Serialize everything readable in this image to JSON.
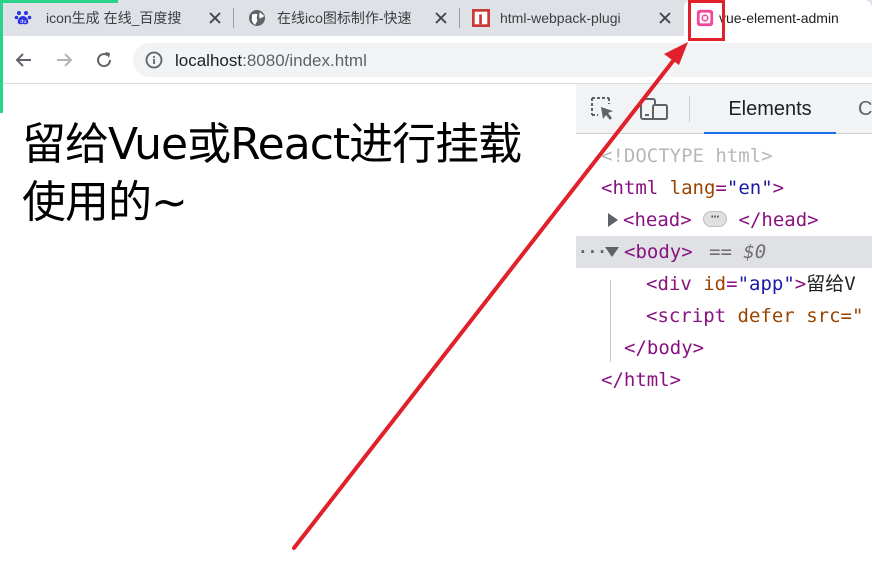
{
  "browser": {
    "tabs": [
      {
        "title": "icon生成 在线_百度搜",
        "favicon": "baidu-paw-icon"
      },
      {
        "title": "在线ico图标制作-快速",
        "favicon": "globe-icon"
      },
      {
        "title": "html-webpack-plugi",
        "favicon": "npm-icon"
      },
      {
        "title": "vue-element-admin",
        "favicon": "vue-element-admin-icon",
        "active": true
      }
    ],
    "close_glyph": "✕",
    "url_host": "localhost",
    "url_path": ":8080/index.html"
  },
  "page": {
    "text": "留给Vue或React进行挂载使用的~"
  },
  "devtools": {
    "tabs": [
      {
        "label": "Elements",
        "active": true
      },
      {
        "label": "C"
      }
    ],
    "dom": {
      "doctype": "<!DOCTYPE html>",
      "html_open_tag": "<html",
      "html_attr_name": "lang",
      "html_attr_value": "\"en\"",
      "html_open_close": ">",
      "head_open": "<head>",
      "head_close": "</head>",
      "ellipsis": "⋯",
      "body_open": "<body>",
      "body_selected_marker": "== $0",
      "row_dots": "···",
      "div_open": "<div",
      "div_attr_name": "id",
      "div_attr_value": "\"app\"",
      "div_gt": ">",
      "div_text": "留给V",
      "script_open": "<script",
      "script_attr_defer": "defer",
      "script_attr_src": "src=\"",
      "body_close": "</body>",
      "html_close": "</html>"
    }
  },
  "colors": {
    "annotation_red": "#e0202a",
    "tab_strip": "#dee1e6",
    "devtools_tag": "#881280",
    "devtools_attr": "#994500",
    "devtools_value": "#1a1aa6",
    "active_underline": "#1a73e8"
  }
}
